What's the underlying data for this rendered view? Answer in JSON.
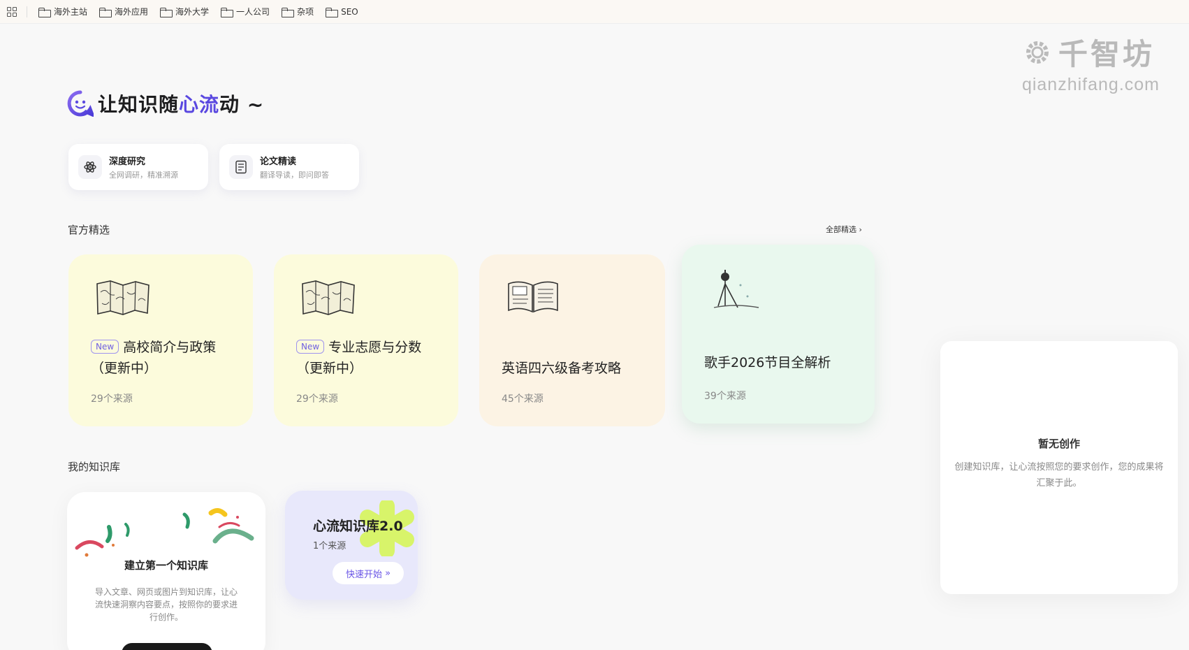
{
  "bookmarks": [
    {
      "label": "海外主站"
    },
    {
      "label": "海外应用"
    },
    {
      "label": "海外大学"
    },
    {
      "label": "一人公司"
    },
    {
      "label": "杂项"
    },
    {
      "label": "SEO"
    }
  ],
  "watermark": {
    "title": "千智坊",
    "url": "qianzhifang.com"
  },
  "hero": {
    "title_part1": "让知识随",
    "title_accent": "心流",
    "title_part2": "动 ~"
  },
  "quick_actions": [
    {
      "title": "深度研究",
      "subtitle": "全网调研，精准溯源",
      "icon": "atom-icon"
    },
    {
      "title": "论文精读",
      "subtitle": "翻译导读，即问即答",
      "icon": "document-icon"
    }
  ],
  "official": {
    "section_title": "官方精选",
    "see_all": "全部精选",
    "cards": [
      {
        "badge": "New",
        "title": "高校简介与政策（更新中）",
        "count": "29个来源",
        "illustration": "map-icon",
        "color": "#fcfbdc"
      },
      {
        "badge": "New",
        "title": "专业志愿与分数（更新中）",
        "count": "29个来源",
        "illustration": "map-icon",
        "color": "#fcfbdc"
      },
      {
        "title": "英语四六级备考攻略",
        "count": "45个来源",
        "illustration": "book-icon",
        "color": "#fcf3e4"
      },
      {
        "title": "歌手2026节目全解析",
        "count": "39个来源",
        "illustration": "microphone-icon",
        "color": "#e9f8ee"
      }
    ]
  },
  "my_kb": {
    "section_title": "我的知识库",
    "create": {
      "title": "建立第一个知识库",
      "desc": "导入文章、网页或图片到知识库，让心流快速洞察内容要点，按照你的要求进行创作。"
    },
    "kb_card": {
      "title": "心流知识库2.0",
      "count": "1个来源",
      "button": "快速开始"
    }
  },
  "creation_panel": {
    "title": "暂无创作",
    "desc": "创建知识库，让心流按照您的要求创作，您的成果将汇聚于此。"
  }
}
